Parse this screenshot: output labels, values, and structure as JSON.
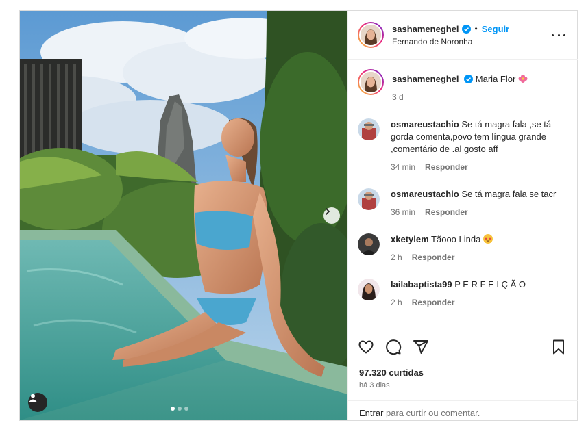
{
  "post": {
    "author": {
      "username": "sashameneghel",
      "verified_icon": "verified-badge-icon",
      "follow_label": "Seguir",
      "separator": "•",
      "location": "Fernando de Noronha"
    },
    "caption": {
      "username": "sashameneghel",
      "text": "Maria Flor",
      "emoji": "hibiscus-emoji",
      "time": "3 d"
    },
    "comments": [
      {
        "username": "osmareustachio",
        "text": "Se tá magra fala ,se tá gorda comenta,povo tem língua grande ,comentário de .al gosto aff",
        "time": "34 min",
        "reply_label": "Responder"
      },
      {
        "username": "osmareustachio",
        "text": "Se tá magra fala se tacr",
        "time": "36 min",
        "reply_label": "Responder"
      },
      {
        "username": "xketylem",
        "text": "Tãooo Linda",
        "emoji": "star-struck-emoji",
        "time": "2 h",
        "reply_label": "Responder"
      },
      {
        "username": "lailabaptista99",
        "text": "P E R F E I Ç Ã O",
        "time": "2 h",
        "reply_label": "Responder"
      }
    ],
    "likes": "97.320 curtidas",
    "date": "há 3 dias",
    "login_prompt": {
      "link": "Entrar",
      "rest": " para curtir ou comentar."
    },
    "carousel": {
      "slides": 3,
      "active": 1
    },
    "icons": {
      "like": "heart-icon",
      "comment": "comment-icon",
      "share": "send-icon",
      "save": "bookmark-icon",
      "more": "more-options-icon",
      "next": "chevron-right-icon",
      "tags": "user-tag-icon"
    },
    "colors": {
      "accent": "#0095f6",
      "text": "#262626",
      "muted": "#737373",
      "border": "#dbdbdb"
    }
  }
}
